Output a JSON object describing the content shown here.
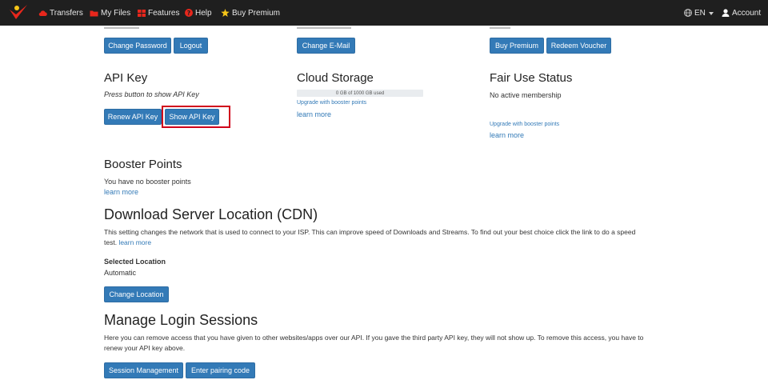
{
  "nav": {
    "transfers": "Transfers",
    "my_files": "My Files",
    "features": "Features",
    "help": "Help",
    "buy_premium": "Buy Premium",
    "lang": "EN",
    "account": "Account"
  },
  "top_row": {
    "change_password": "Change Password",
    "logout": "Logout",
    "change_email": "Change E-Mail",
    "buy_premium": "Buy Premium",
    "redeem_voucher": "Redeem Voucher"
  },
  "api_key": {
    "title": "API Key",
    "hint": "Press button to show API Key",
    "renew": "Renew API Key",
    "show": "Show API Key"
  },
  "cloud_storage": {
    "title": "Cloud Storage",
    "used": "0 GB of 1000 GB used",
    "used_fraction": 0,
    "upgrade": "Upgrade with booster points",
    "learn_more": "learn more"
  },
  "fair_use": {
    "title": "Fair Use Status",
    "status": "No active membership",
    "upgrade": "Upgrade with booster points",
    "learn_more": "learn more"
  },
  "booster": {
    "title": "Booster Points",
    "text": "You have no booster points",
    "learn_more": "learn more"
  },
  "cdn": {
    "title": "Download Server Location (CDN)",
    "desc_line1": "This setting changes the network that is used to connect to your ISP. This can improve speed of Downloads and Streams. To find out your best choice click the link to do a speed",
    "desc_line2_text": "test.",
    "learn_more": "learn more",
    "selected_label": "Selected Location",
    "selected_value": "Automatic",
    "change_btn": "Change Location"
  },
  "sessions": {
    "title": "Manage Login Sessions",
    "desc_line1": "Here you can remove access that you have given to other websites/apps over our API. If you gave the third party API key, they will not show up. To remove this access, you have to",
    "desc_line2": "renew your API key above.",
    "session_mgmt": "Session Management",
    "pairing": "Enter pairing code"
  },
  "colors": {
    "navbar": "#1f1f1f",
    "button": "#337ab7",
    "link": "#337ab7",
    "highlight": "#d0021b"
  },
  "icons": [
    "logo-icon",
    "cloud-icon",
    "folder-icon",
    "grid-icon",
    "help-icon",
    "star-icon",
    "globe-icon",
    "caret-down-icon",
    "user-icon"
  ]
}
